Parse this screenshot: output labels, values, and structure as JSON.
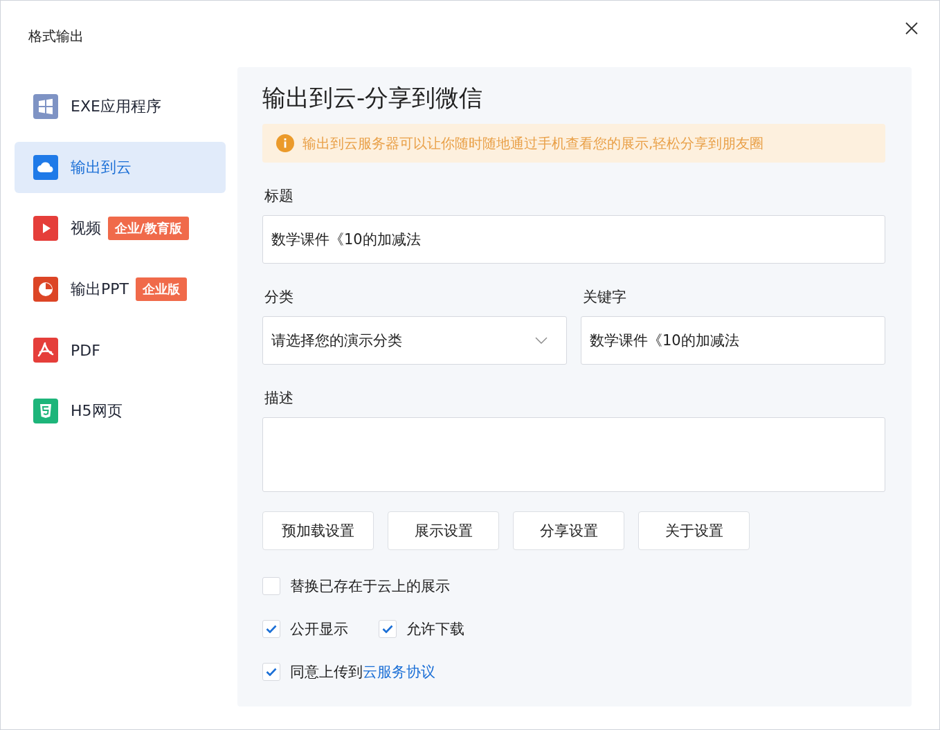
{
  "window": {
    "title": "格式输出"
  },
  "sidebar": {
    "items": [
      {
        "kind": "exe",
        "label": "EXE应用程序",
        "selected": false
      },
      {
        "kind": "cloud",
        "label": "输出到云",
        "selected": true
      },
      {
        "kind": "video",
        "label": "视频",
        "badge": "企业/教育版",
        "selected": false
      },
      {
        "kind": "ppt",
        "label": "输出PPT",
        "badge": "企业版",
        "selected": false
      },
      {
        "kind": "pdf",
        "label": "PDF",
        "selected": false
      },
      {
        "kind": "h5",
        "label": "H5网页",
        "selected": false
      }
    ]
  },
  "panel": {
    "heading": "输出到云-分享到微信",
    "notice": "输出到云服务器可以让你随时随地通过手机查看您的展示,轻松分享到朋友圈",
    "title_field": {
      "label": "标题",
      "value": "数学课件《10的加减法"
    },
    "category_field": {
      "label": "分类",
      "value": "请选择您的演示分类"
    },
    "keywords_field": {
      "label": "关键字",
      "value": "数学课件《10的加减法"
    },
    "description_field": {
      "label": "描述"
    },
    "buttons": [
      "预加载设置",
      "展示设置",
      "分享设置",
      "关于设置"
    ],
    "checkbox_rows": [
      [
        {
          "label": "替换已存在于云上的展示",
          "checked": false
        }
      ],
      [
        {
          "label": "公开显示",
          "checked": true
        },
        {
          "label": "允许下载",
          "checked": true
        }
      ],
      [
        {
          "label": "同意上传到",
          "link": "云服务协议",
          "checked": true
        }
      ]
    ]
  }
}
